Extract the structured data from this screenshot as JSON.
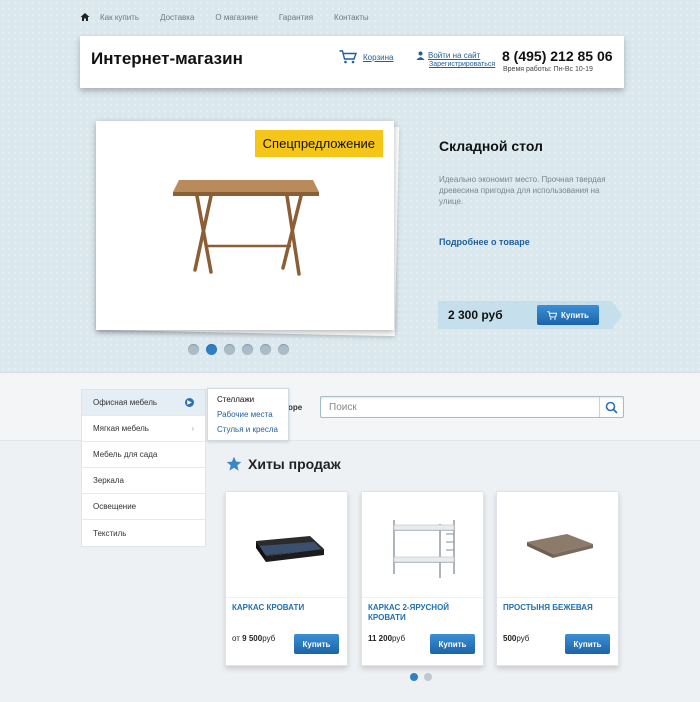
{
  "topnav": {
    "items": [
      "Как купить",
      "Доставка",
      "О магазине",
      "Гарантия",
      "Контакты"
    ]
  },
  "header": {
    "brand": "Интернет-магазин",
    "cart_label": "Корзина",
    "login_label": "Войти на сайт",
    "register_label": "Зарегистрироваться",
    "phone": "8 (495) 212 85 06",
    "hours": "Время работы: Пн-Вс 10-19"
  },
  "hero": {
    "badge": "Спецпредложение",
    "title": "Складной стол",
    "description": "Идеально экономит место. Прочная твердая древесина пригодна для использования на улице.",
    "more_link": "Подробнее о товаре",
    "price": "2 300 руб",
    "buy_label": "Купить",
    "slide_count": 6,
    "active_slide": 2
  },
  "catalog": {
    "items": [
      "Офисная мебель",
      "Мягкая мебель",
      "Мебель для сада",
      "Зеркала",
      "Освещение",
      "Текстиль"
    ],
    "submenu": [
      "Стеллажи",
      "Рабочие места",
      "Стулья и кресла"
    ],
    "partial_text": "оре"
  },
  "search": {
    "placeholder": "Поиск"
  },
  "hits": {
    "title": "Хиты продаж",
    "products": [
      {
        "name": "КАРКАС КРОВАТИ",
        "price_prefix": "от ",
        "price_value": "9 500",
        "price_unit": "руб",
        "buy_label": "Купить"
      },
      {
        "name": "КАРКАС 2-ЯРУСНОЙ КРОВАТИ",
        "price_prefix": "",
        "price_value": "11 200",
        "price_unit": "руб",
        "buy_label": "Купить"
      },
      {
        "name": "ПРОСТЫНЯ БЕЖЕВАЯ",
        "price_prefix": "",
        "price_value": "500",
        "price_unit": "руб",
        "buy_label": "Купить"
      }
    ],
    "page_count": 2,
    "active_page": 1
  },
  "colors": {
    "accent": "#2f7fc4",
    "badge": "#f5c518",
    "link": "#1f5f9e"
  }
}
